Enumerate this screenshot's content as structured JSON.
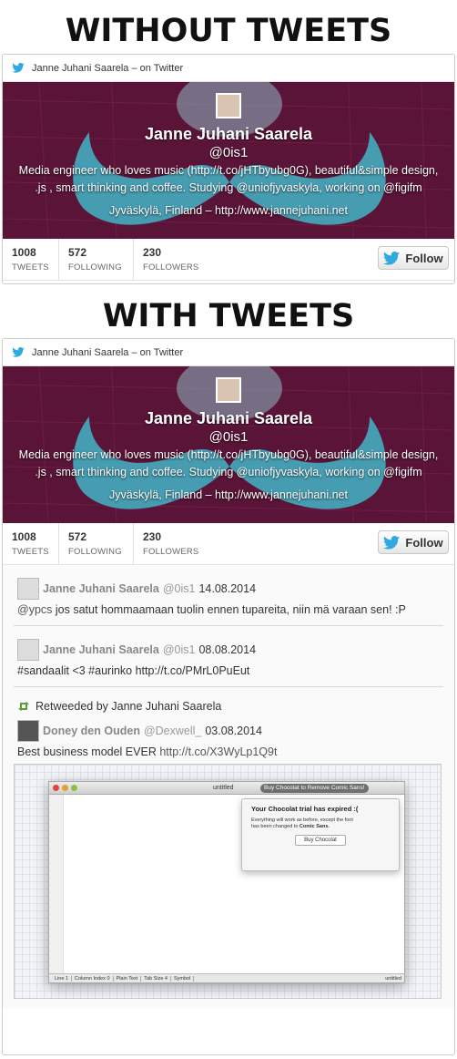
{
  "headings": {
    "without": "WITHOUT TWEETS",
    "with": "WITH TWEETS"
  },
  "widget": {
    "header": "Janne Juhani Saarela – on Twitter",
    "name": "Janne Juhani Saarela",
    "handle": "@0is1",
    "bio_line1": "Media engineer who loves music (http://t.co/jHTbyubg0G), beautiful&simple design,",
    "bio_line2": ".js , smart thinking and coffee. Studying @uniofjyvaskyla, working on @figifm",
    "location": "Jyväskylä, Finland – http://www.jannejuhani.net",
    "stats": [
      {
        "num": "1008",
        "label": "TWEETS"
      },
      {
        "num": "572",
        "label": "FOLLOWING"
      },
      {
        "num": "230",
        "label": "FOLLOWERS"
      }
    ],
    "follow_label": "Follow",
    "colors": {
      "banner": "#5a1437",
      "twitter_blue": "#2fa9e0",
      "retweet_green": "#5c9e3a"
    }
  },
  "tweets": [
    {
      "name": "Janne Juhani Saarela",
      "handle": "@0is1",
      "date": "14.08.2014",
      "text_link": "@ypcs",
      "text": " jos satut hommaamaan tuolin ennen tupareita, niin mä varaan sen! :P"
    },
    {
      "name": "Janne Juhani Saarela",
      "handle": "@0is1",
      "date": "08.08.2014",
      "text": "#sandaalit <3 #aurinko http://t.co/PMrL0PuEut"
    },
    {
      "retweeted_by": "Retweeded by Janne Juhani Saarela",
      "name": "Doney den Ouden",
      "handle": "@Dexwell_",
      "date": "03.08.2014",
      "text": "Best business model EVER ",
      "text_link": "http://t.co/X3WyLp1Q9t"
    }
  ],
  "media": {
    "window_title": "untitled",
    "pill": "Buy Chocolat to Remove Comic Sans!",
    "popup_title": "Your Chocolat trial has expired :(",
    "popup_text_1": "Everything will work as before, except the font",
    "popup_text_2": "has been changed to ",
    "popup_text_bold": "Comic Sans.",
    "popup_button": "Buy Chocolat",
    "status_items": [
      "Line 1",
      "Column Index 0",
      "Plain Text",
      "Tab Size 4",
      "Symbol"
    ],
    "status_right": "untitled"
  }
}
